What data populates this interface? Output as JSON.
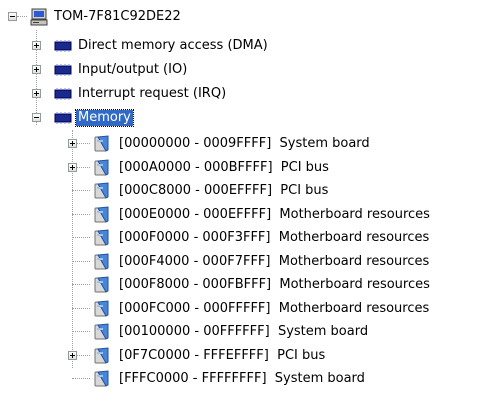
{
  "tree": {
    "computer": {
      "label": "TOM-7F81C92DE22",
      "icon": "computer-icon",
      "expanded": true
    },
    "categories": [
      {
        "label": "Direct memory access (DMA)",
        "icon": "chip-icon",
        "expanded": false
      },
      {
        "label": "Input/output (IO)",
        "icon": "chip-icon",
        "expanded": false
      },
      {
        "label": "Interrupt request (IRQ)",
        "icon": "chip-icon",
        "expanded": false
      },
      {
        "label": "Memory",
        "icon": "chip-icon",
        "expanded": true,
        "selected": true
      }
    ],
    "memory_items": [
      {
        "label": "[00000000 - 0009FFFF]  System board",
        "icon": "device-icon",
        "expandable": true
      },
      {
        "label": "[000A0000 - 000BFFFF]  PCI bus",
        "icon": "device-icon",
        "expandable": true
      },
      {
        "label": "[000C8000 - 000EFFFF]  PCI bus",
        "icon": "device-icon",
        "expandable": false
      },
      {
        "label": "[000E0000 - 000EFFFF]  Motherboard resources",
        "icon": "device-icon",
        "expandable": false
      },
      {
        "label": "[000F0000 - 000F3FFF]  Motherboard resources",
        "icon": "device-icon",
        "expandable": false
      },
      {
        "label": "[000F4000 - 000F7FFF]  Motherboard resources",
        "icon": "device-icon",
        "expandable": false
      },
      {
        "label": "[000F8000 - 000FBFFF]  Motherboard resources",
        "icon": "device-icon",
        "expandable": false
      },
      {
        "label": "[000FC000 - 000FFFFF]  Motherboard resources",
        "icon": "device-icon",
        "expandable": false
      },
      {
        "label": "[00100000 - 00FFFFFF]  System board",
        "icon": "device-icon",
        "expandable": false
      },
      {
        "label": "[0F7C0000 - FFFEFFFF]  PCI bus",
        "icon": "device-icon",
        "expandable": true
      },
      {
        "label": "[FFFC0000 - FFFFFFFF]  System board",
        "icon": "device-icon",
        "expandable": false
      }
    ]
  }
}
